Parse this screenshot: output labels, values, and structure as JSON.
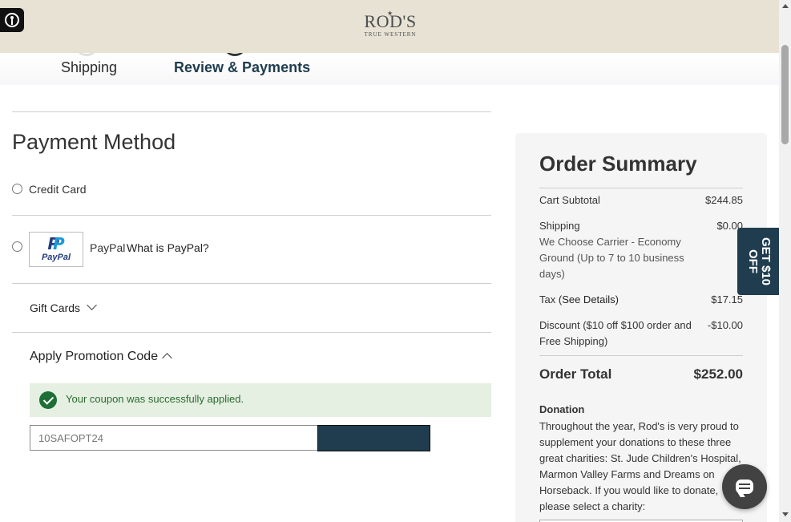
{
  "header": {
    "logo_brand": "ROD'S",
    "logo_sub": "TRUE WESTERN",
    "accessibility_icon": "accessibility-icon"
  },
  "steps": [
    {
      "label": "Shipping",
      "active": false
    },
    {
      "label": "Review & Payments",
      "active": true
    }
  ],
  "payment": {
    "title": "Payment Method",
    "credit_card_label": "Credit Card",
    "paypal_label": "PayPal",
    "paypal_link": "What is PayPal?",
    "paypal_logo_text": "PayPal",
    "gift_cards_label": "Gift Cards",
    "promo_title": "Apply Promotion Code",
    "success_message": "Your coupon was successfully applied.",
    "coupon_value": "10SAFOPT24"
  },
  "summary": {
    "title": "Order Summary",
    "subtotal_label": "Cart Subtotal",
    "subtotal_value": "$244.85",
    "shipping_label": "Shipping",
    "shipping_value": "$0.00",
    "shipping_detail": "We Choose Carrier - Economy Ground (Up to 7 to 10 business days)",
    "tax_label": "Tax",
    "tax_link": "(See Details)",
    "tax_value": "$17.15",
    "discount_label": "Discount ($10 off $100 order and Free Shipping)",
    "discount_value": "-$10.00",
    "total_label": "Order Total",
    "total_value": "$252.00",
    "donation_title": "Donation",
    "donation_text": "Throughout the year, Rod's is very proud to supplement your donations to these three great charities: St. Jude Children's Hospital, Marmon Valley Farms and Dreams on Horseback. If you would like to donate, please select a charity:"
  },
  "promo_tab": "GET $10 OFF",
  "colors": {
    "header_bg": "#e8e2d5",
    "accent": "#1f3d4f",
    "success_bg": "#e5efe2",
    "success_text": "#2a6b2e"
  }
}
